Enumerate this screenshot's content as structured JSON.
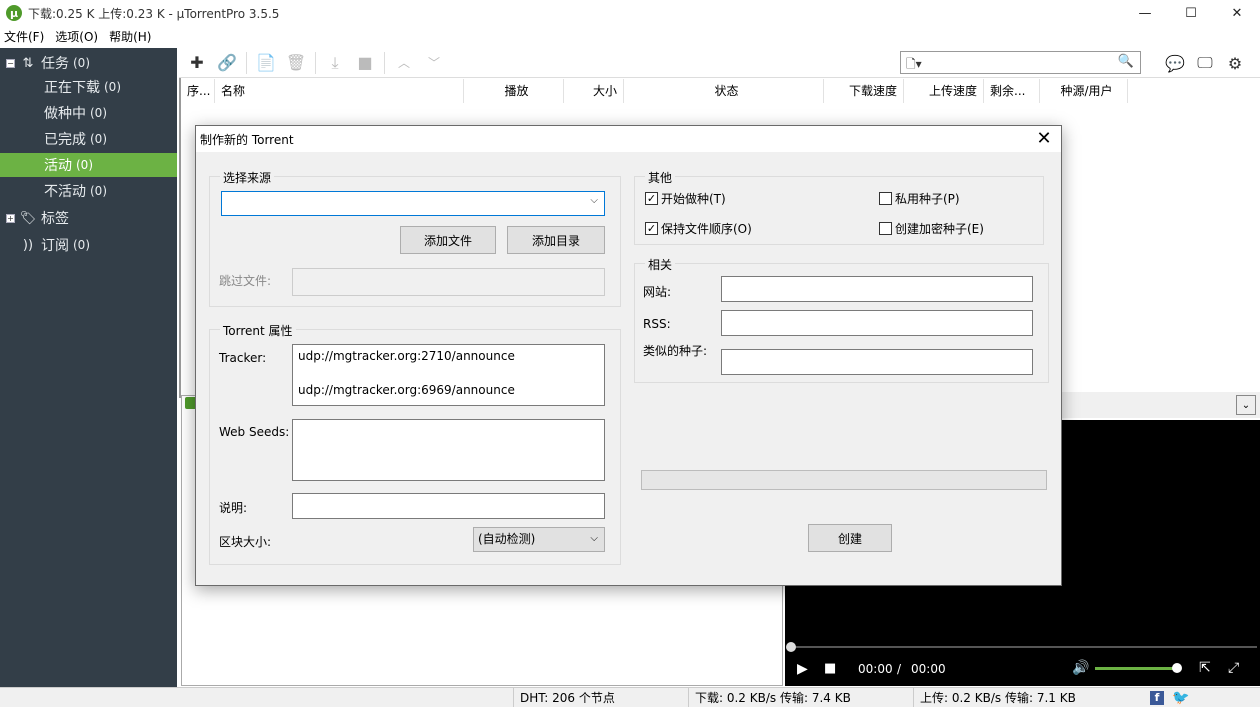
{
  "window": {
    "title": "下载:0.25 K 上传:0.23 K - µTorrentPro 3.5.5",
    "minimize": "—",
    "maximize": "☐",
    "close": "✕"
  },
  "menu": [
    "文件(F)",
    "选项(O)",
    "帮助(H)"
  ],
  "sidebar": {
    "items": [
      {
        "label": "任务",
        "count": "(0)",
        "expander": "−",
        "icon": "transfer-arrows-icon"
      },
      {
        "label": "正在下载",
        "count": "(0)"
      },
      {
        "label": "做种中",
        "count": "(0)"
      },
      {
        "label": "已完成",
        "count": "(0)"
      },
      {
        "label": "活动",
        "count": "(0)",
        "active": true
      },
      {
        "label": "不活动",
        "count": "(0)"
      },
      {
        "label": "标签",
        "count": "",
        "expander": "+",
        "icon": "tag-icon"
      },
      {
        "label": "订阅",
        "count": "(0)",
        "icon": "rss-icon"
      }
    ]
  },
  "toolbar": {
    "search_value": ""
  },
  "columns": [
    "序...",
    "名称",
    "播放",
    "大小",
    "状态",
    "下载速度",
    "上传速度",
    "剩余...",
    "种源/用户"
  ],
  "video": {
    "current_time": "00:00",
    "separator": "/",
    "total_time": "00:00"
  },
  "statusbar": {
    "dht": "DHT: 206 个节点",
    "download": "下载: 0.2 KB/s 传输: 7.4 KB",
    "upload": "上传: 0.2 KB/s 传输: 7.1 KB"
  },
  "dialog": {
    "title": "制作新的 Torrent",
    "source_group": "选择来源",
    "source_value": "",
    "add_file": "添加文件",
    "add_dir": "添加目录",
    "skip_files_label": "跳过文件:",
    "skip_files_value": "",
    "props_group": "Torrent 属性",
    "tracker_label": "Tracker:",
    "trackers": [
      "udp://mgtracker.org:2710/announce",
      "udp://mgtracker.org:6969/announce"
    ],
    "webseeds_label": "Web Seeds:",
    "webseeds_value": "",
    "comment_label": "说明:",
    "comment_value": "",
    "piece_label": "区块大小:",
    "piece_value": "(自动检测)",
    "other_group": "其他",
    "start_seeding": "开始做种(T)",
    "start_seeding_checked": true,
    "private_torrent": "私用种子(P)",
    "private_checked": false,
    "preserve_order": "保持文件顺序(O)",
    "preserve_checked": true,
    "encrypted": "创建加密种子(E)",
    "encrypted_checked": false,
    "related_group": "相关",
    "website_label": "网站:",
    "website_value": "",
    "rss_label": "RSS:",
    "rss_value": "",
    "similar_label": "类似的种子:",
    "similar_value": "",
    "progress": 0,
    "create": "创建"
  },
  "colors": {
    "sidebar_bg": "#333e48",
    "accent": "#6cb244",
    "dialog_bg": "#f0f0f0"
  }
}
